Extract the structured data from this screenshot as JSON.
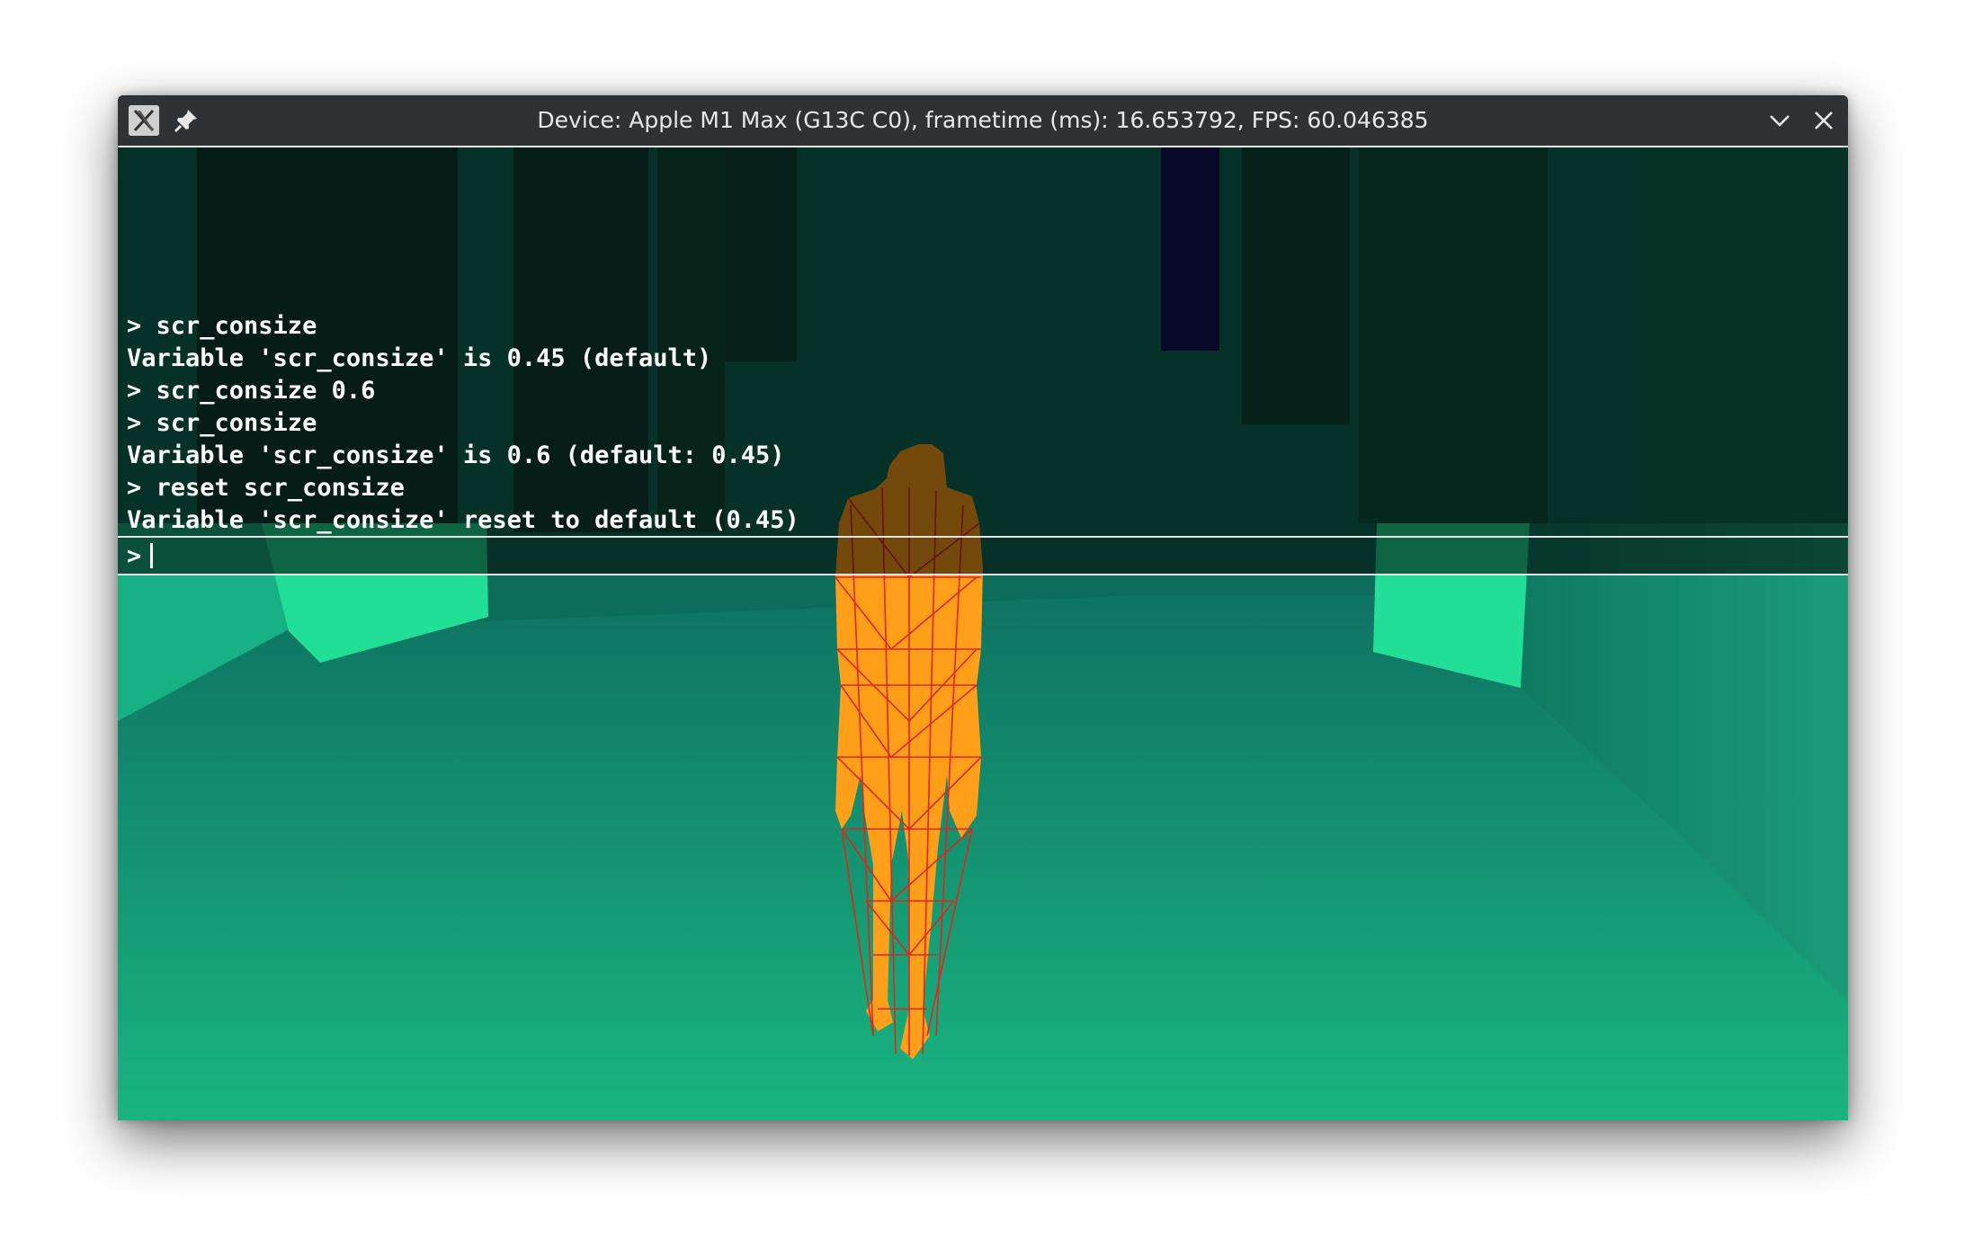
{
  "window": {
    "title": "Device: Apple M1 Max (G13C C0), frametime (ms): 16.653792, FPS: 60.046385",
    "icons": {
      "app": "x-app-icon",
      "pin": "pin-icon",
      "minimize": "chevron-down-icon",
      "close": "close-icon"
    }
  },
  "console": {
    "lines": [
      "> scr_consize",
      "Variable 'scr_consize' is 0.45 (default)",
      "> scr_consize 0.6",
      "> scr_consize",
      "Variable 'scr_consize' is 0.6 (default: 0.45)",
      "> reset scr_consize",
      "Variable 'scr_consize' reset to default (0.45)"
    ],
    "prompt": ">",
    "input_value": ""
  },
  "colors": {
    "floor_top": "#0f7864",
    "floor_bottom": "#19b580",
    "wall_light": "#21df96",
    "character_fill": "#ff9f1a",
    "wireframe": "#e0261c"
  }
}
